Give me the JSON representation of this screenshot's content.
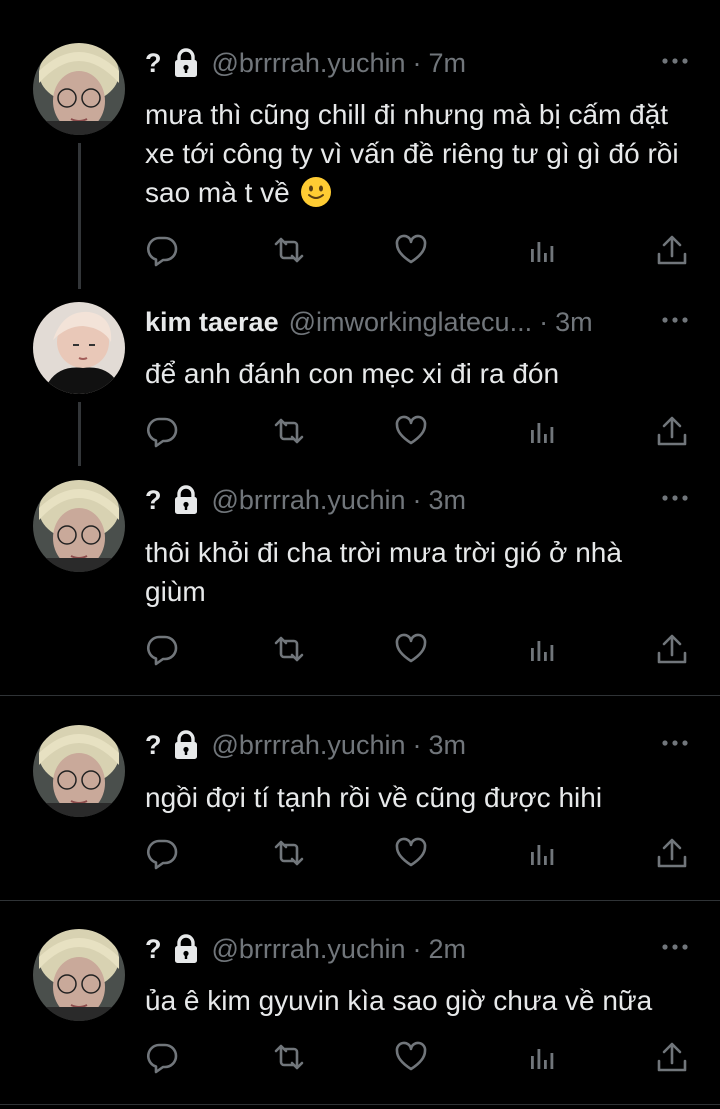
{
  "tweets": [
    {
      "name": "?",
      "locked": true,
      "handle": "@brrrrah.yuchin",
      "separator": "·",
      "time": "7m",
      "text": "mưa thì cũng chill đi nhưng mà bị cấm đặt xe tới công ty vì vấn đề riêng tư gì gì đó rồi sao mà t về",
      "emoji": "slightly-smiling-face"
    },
    {
      "name": "kim taerae",
      "locked": false,
      "handle": "@imworkinglatecu...",
      "separator": "·",
      "time": "3m",
      "text": "để anh đánh con mẹc xi đi ra đón"
    },
    {
      "name": "?",
      "locked": true,
      "handle": "@brrrrah.yuchin",
      "separator": "·",
      "time": "3m",
      "text": "thôi khỏi đi cha trời mưa trời gió ở nhà giùm"
    },
    {
      "name": "?",
      "locked": true,
      "handle": "@brrrrah.yuchin",
      "separator": "·",
      "time": "3m",
      "text": "ngồi đợi tí tạnh rồi về cũng được hihi"
    },
    {
      "name": "?",
      "locked": true,
      "handle": "@brrrrah.yuchin",
      "separator": "·",
      "time": "2m",
      "text": "ủa ê kim gyuvin kìa sao giờ chưa về nữa"
    }
  ],
  "icons": {
    "reply": "reply-icon",
    "retweet": "retweet-icon",
    "like": "like-icon",
    "views": "views-icon",
    "share": "share-icon",
    "more": "more-icon",
    "lock": "lock-icon"
  },
  "colors": {
    "background": "#000000",
    "text": "#e7e9ea",
    "muted": "#71767b",
    "divider": "#2f3336",
    "thread_line": "#333639"
  }
}
